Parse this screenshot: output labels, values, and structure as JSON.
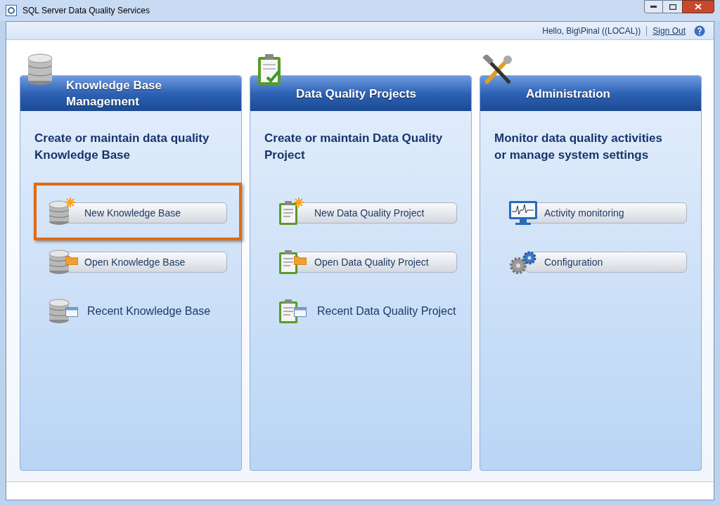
{
  "window": {
    "title": "SQL Server Data Quality Services"
  },
  "user_bar": {
    "greeting": "Hello, Big\\Pinal ((LOCAL))",
    "sign_out": "Sign Out"
  },
  "panels": [
    {
      "kind": "knowledge",
      "title": "Knowledge Base Management",
      "description": "Create or maintain data quality Knowledge Base",
      "items": [
        {
          "kind": "button",
          "label": "New Knowledge Base",
          "highlighted": true
        },
        {
          "kind": "button",
          "label": "Open Knowledge Base",
          "highlighted": false
        },
        {
          "kind": "link",
          "label": "Recent Knowledge Base",
          "highlighted": false
        }
      ]
    },
    {
      "kind": "project",
      "title": "Data Quality Projects",
      "description": "Create or maintain Data Quality Project",
      "items": [
        {
          "kind": "button",
          "label": "New Data Quality Project",
          "highlighted": false
        },
        {
          "kind": "button",
          "label": "Open Data Quality Project",
          "highlighted": false
        },
        {
          "kind": "link",
          "label": "Recent Data Quality Project",
          "highlighted": false
        }
      ]
    },
    {
      "kind": "admin",
      "title": "Administration",
      "description": "Monitor data quality activities or manage system settings",
      "items": [
        {
          "kind": "button",
          "label": "Activity monitoring",
          "highlighted": false
        },
        {
          "kind": "button",
          "label": "Configuration",
          "highlighted": false
        }
      ]
    }
  ]
}
